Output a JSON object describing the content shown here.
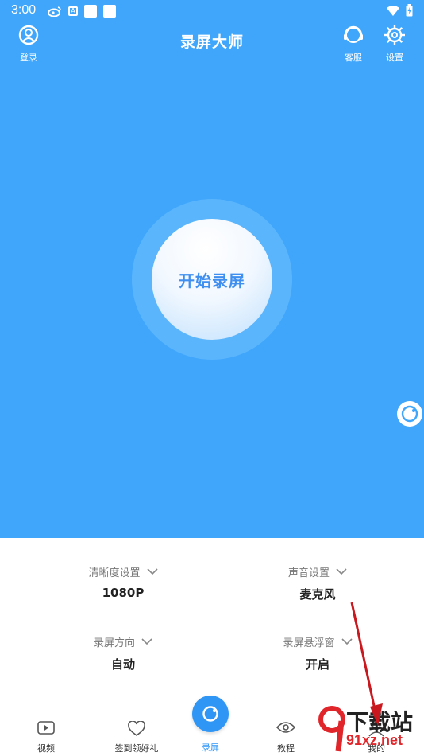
{
  "status_bar": {
    "time": "3:00"
  },
  "header": {
    "title": "录屏大师",
    "login_label": "登录",
    "service_label": "客服",
    "settings_label": "设置"
  },
  "record": {
    "label": "开始录屏"
  },
  "settings": [
    {
      "title": "清晰度设置",
      "value": "1080P"
    },
    {
      "title": "声音设置",
      "value": "麦克风"
    },
    {
      "title": "录屏方向",
      "value": "自动"
    },
    {
      "title": "录屏悬浮窗",
      "value": "开启"
    }
  ],
  "bottom_nav": [
    {
      "label": "视频",
      "icon": "video-icon"
    },
    {
      "label": "签到领好礼",
      "icon": "heart-icon"
    },
    {
      "label": "录屏",
      "icon": "record-icon"
    },
    {
      "label": "教程",
      "icon": "eye-icon"
    },
    {
      "label": "我的",
      "icon": "user-icon"
    }
  ],
  "watermark": {
    "big": "下载站",
    "small": "91xz.net"
  },
  "colors": {
    "primary": "#3fa6fb",
    "accent": "#2f96f5",
    "arrow": "#c9191e"
  }
}
